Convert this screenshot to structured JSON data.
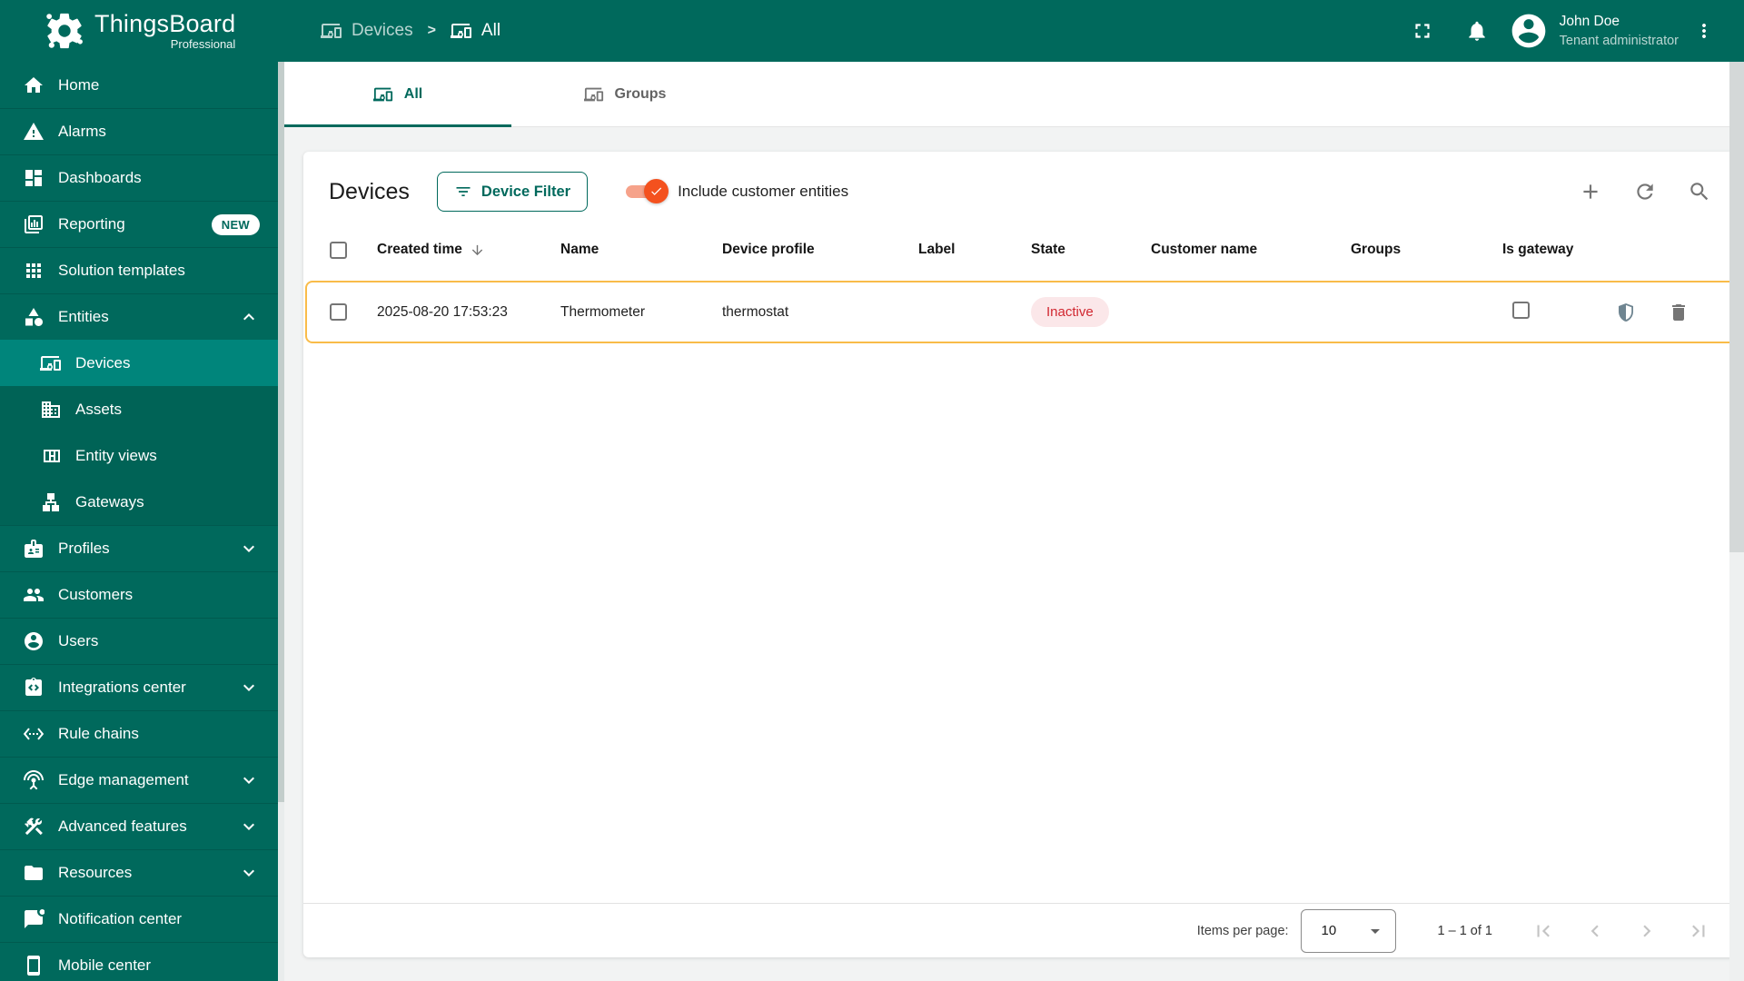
{
  "app": {
    "logo": {
      "title": "ThingsBoard",
      "subtitle": "Professional"
    },
    "breadcrumb": {
      "separator": ">",
      "items": [
        {
          "icon": "devices",
          "label": "Devices",
          "muted": true
        },
        {
          "icon": "devices",
          "label": "All",
          "muted": false
        }
      ]
    },
    "user": {
      "name": "John Doe",
      "role": "Tenant administrator"
    }
  },
  "colors": {
    "primary_teal": "#00695C",
    "selected_nav": "#00857B",
    "accent_orange": "#F4511E",
    "row_highlight_border": "#F9BC49",
    "inactive_text": "#D12730",
    "inactive_bg": "#FBE7E9",
    "icon_gray": "#757575"
  },
  "sidebar": {
    "items": [
      {
        "icon": "home",
        "label": "Home"
      },
      {
        "icon": "alarms",
        "label": "Alarms"
      },
      {
        "icon": "dashboards",
        "label": "Dashboards"
      },
      {
        "icon": "reporting",
        "label": "Reporting",
        "badge": "NEW"
      },
      {
        "icon": "solution-templates",
        "label": "Solution templates"
      },
      {
        "icon": "entities",
        "label": "Entities",
        "chevron": "up"
      },
      {
        "icon": "devices",
        "label": "Devices",
        "child": true,
        "selected": true
      },
      {
        "icon": "assets",
        "label": "Assets",
        "child": true
      },
      {
        "icon": "entity-views",
        "label": "Entity views",
        "child": true
      },
      {
        "icon": "gateways",
        "label": "Gateways",
        "child": true
      },
      {
        "icon": "profiles",
        "label": "Profiles",
        "chevron": "down"
      },
      {
        "icon": "customers",
        "label": "Customers"
      },
      {
        "icon": "users",
        "label": "Users"
      },
      {
        "icon": "integrations-center",
        "label": "Integrations center",
        "chevron": "down"
      },
      {
        "icon": "rule-chains",
        "label": "Rule chains"
      },
      {
        "icon": "edge-management",
        "label": "Edge management",
        "chevron": "down"
      },
      {
        "icon": "advanced-features",
        "label": "Advanced features",
        "chevron": "down"
      },
      {
        "icon": "resources",
        "label": "Resources",
        "chevron": "down"
      },
      {
        "icon": "notification-center",
        "label": "Notification center"
      },
      {
        "icon": "mobile-center",
        "label": "Mobile center"
      }
    ]
  },
  "tabs": [
    {
      "icon": "devices",
      "label": "All",
      "active": true
    },
    {
      "icon": "devices",
      "label": "Groups",
      "active": false
    }
  ],
  "toolbar": {
    "title": "Devices",
    "filter_button": "Device Filter",
    "toggle_label": "Include customer entities",
    "toggle_on": true
  },
  "table": {
    "columns": [
      {
        "label": "Created time",
        "sorted": "desc"
      },
      {
        "label": "Name"
      },
      {
        "label": "Device profile"
      },
      {
        "label": "Label"
      },
      {
        "label": "State"
      },
      {
        "label": "Customer name"
      },
      {
        "label": "Groups"
      },
      {
        "label": "Is gateway"
      }
    ],
    "rows": [
      {
        "created_time": "2025-08-20 17:53:23",
        "name": "Thermometer",
        "device_profile": "thermostat",
        "label": "",
        "state": "Inactive",
        "customer_name": "",
        "groups": "",
        "is_gateway": false,
        "highlighted": true,
        "actions": [
          {
            "icon": "shield-half",
            "name": "security-button",
            "cls": "shield"
          },
          {
            "icon": "delete",
            "name": "delete-button",
            "cls": "trash"
          }
        ]
      }
    ]
  },
  "footer": {
    "items_per_page_label": "Items per page:",
    "items_per_page": "10",
    "range": "1 – 1 of 1",
    "pager": [
      {
        "icon": "first-page",
        "name": "first-page-button"
      },
      {
        "icon": "chevron-left",
        "name": "previous-page-button"
      },
      {
        "icon": "chevron-right",
        "name": "next-page-button"
      },
      {
        "icon": "last-page",
        "name": "last-page-button"
      }
    ]
  }
}
